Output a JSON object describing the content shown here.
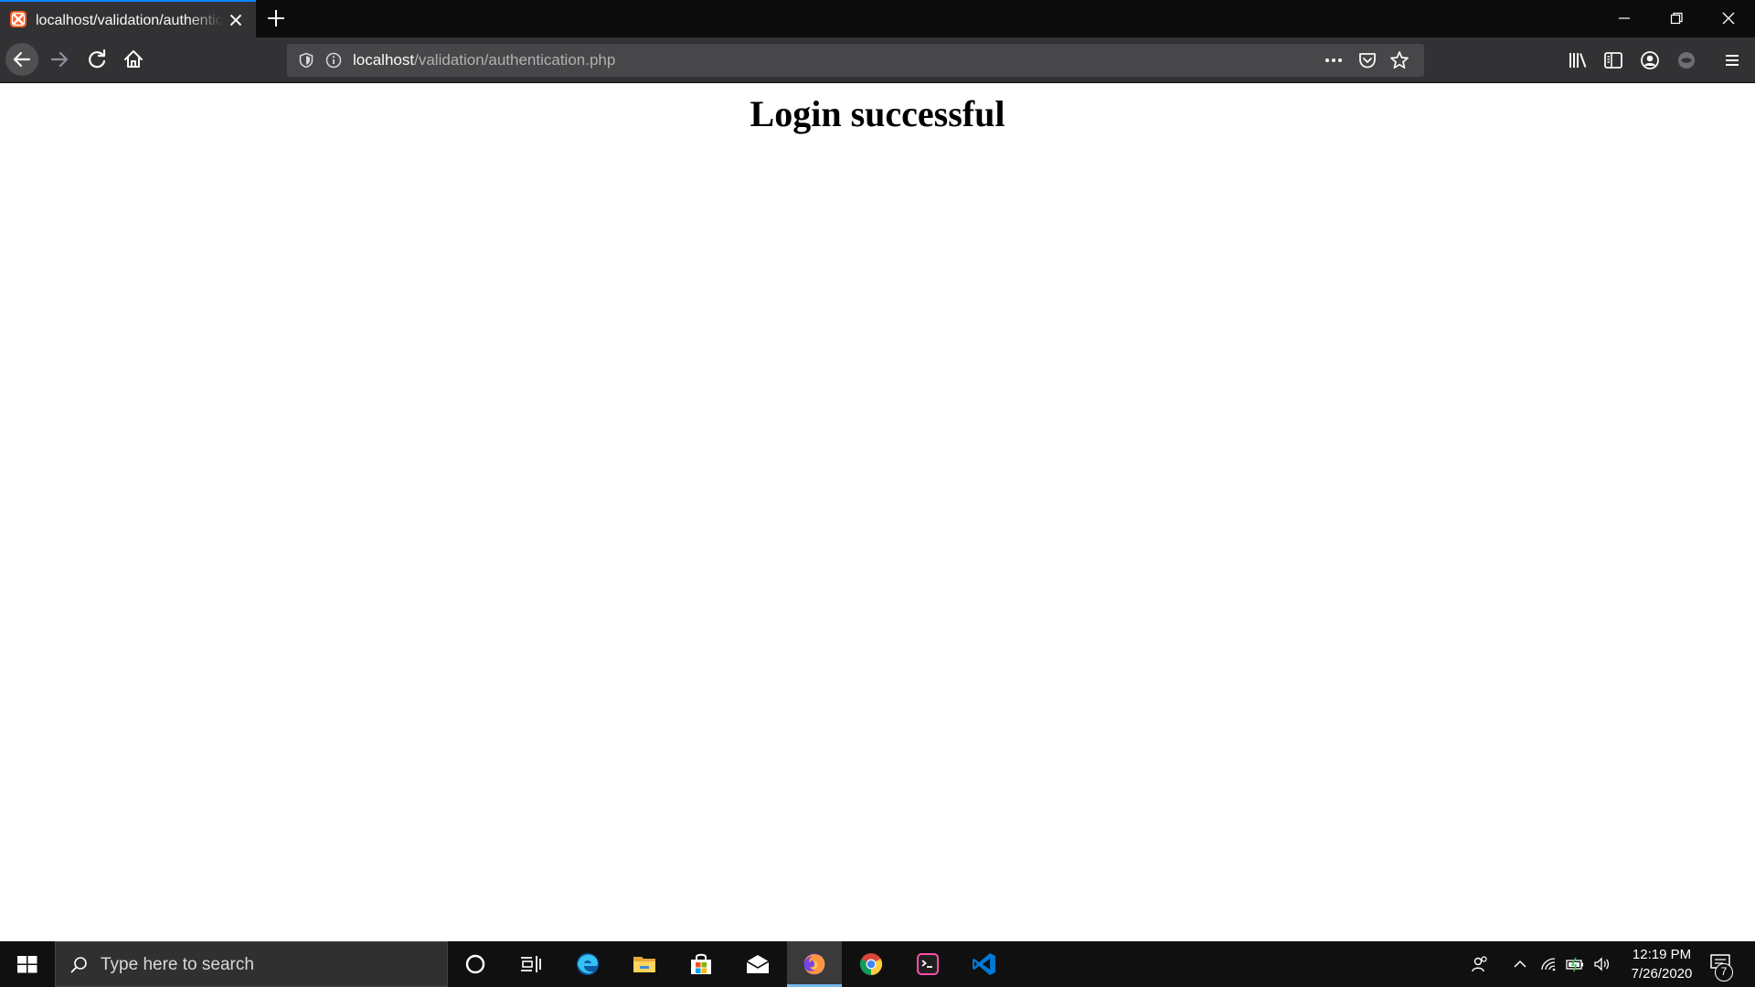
{
  "browser": {
    "tab": {
      "title": "localhost/validation/authentication.php",
      "favicon": "xampp-icon"
    },
    "url": {
      "host": "localhost",
      "path": "/validation/authentication.php"
    },
    "accent_color": "#0a84ff"
  },
  "page": {
    "heading": "Login successful"
  },
  "taskbar": {
    "search_placeholder": "Type here to search",
    "pinned_apps": [
      "cortana",
      "task-view",
      "edge",
      "file-explorer",
      "microsoft-store",
      "mail",
      "firefox",
      "chrome",
      "terminal",
      "vscode"
    ],
    "active_app": "firefox",
    "clock": {
      "time": "12:19 PM",
      "date": "7/26/2020"
    },
    "notification_count": "7"
  }
}
